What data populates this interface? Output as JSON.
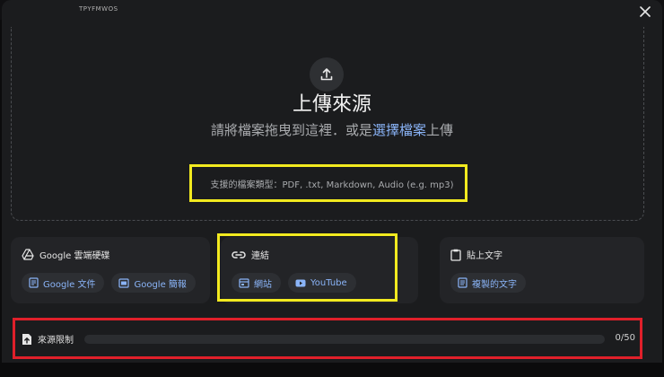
{
  "window": {
    "top_label": "TPYFMWOS"
  },
  "dropzone": {
    "title": "上傳來源",
    "subtitle_prefix": "請將檔案拖曳到這裡．或是",
    "subtitle_link": "選擇檔案",
    "subtitle_suffix": "上傳",
    "supported_types": "支援的檔案類型：PDF, .txt, Markdown, Audio (e.g. mp3)"
  },
  "cards": {
    "drive": {
      "title": "Google 雲端硬碟",
      "chips": [
        "Google 文件",
        "Google 簡報"
      ]
    },
    "link": {
      "title": "連結",
      "chips": [
        "網站",
        "YouTube"
      ]
    },
    "paste": {
      "title": "貼上文字",
      "chips": [
        "複製的文字"
      ]
    }
  },
  "source_limit": {
    "label": "來源限制",
    "count": "0/50",
    "used": 0,
    "max": 50
  },
  "colors": {
    "accent": "#8ab4f8",
    "highlight_yellow": "#f2ea1f",
    "highlight_red": "#e0202a"
  },
  "icons": [
    "upload-icon",
    "close-icon",
    "drive-icon",
    "link-icon",
    "clipboard-icon",
    "docs-icon",
    "slides-icon",
    "website-icon",
    "youtube-icon",
    "paste-text-icon",
    "source-limit-icon"
  ]
}
